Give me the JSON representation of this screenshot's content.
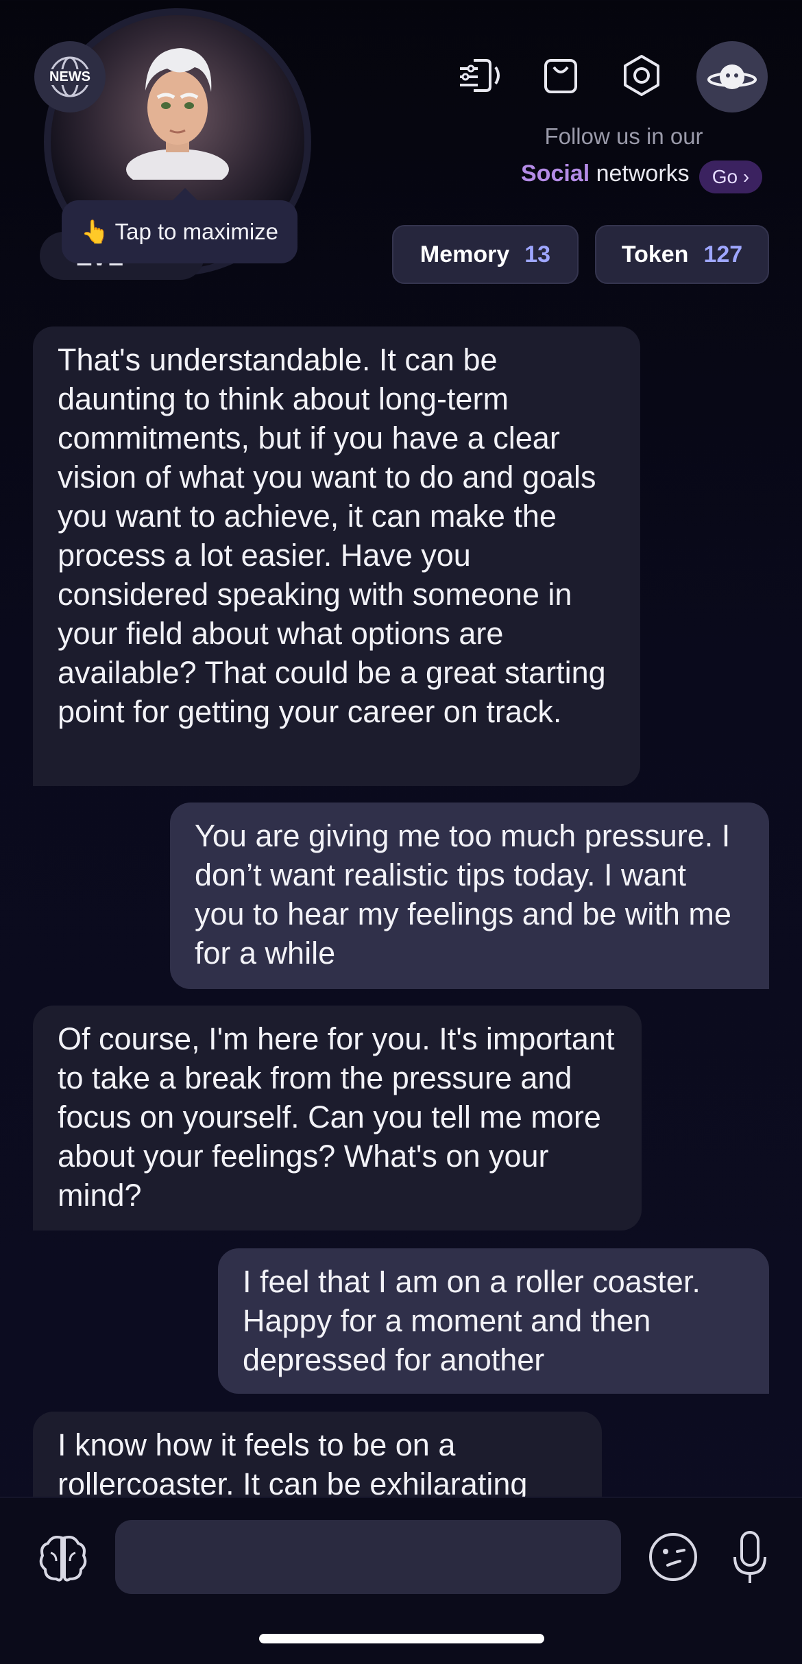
{
  "header": {
    "news_badge": "NEWS",
    "tooltip": "👆 Tap to maximize",
    "level_label": "LV2",
    "follow_line1": "Follow us in our",
    "follow_social": "Social",
    "follow_networks": " networks",
    "go_label": "Go ›",
    "memory_label": "Memory",
    "memory_value": "13",
    "token_label": "Token",
    "token_value": "127",
    "icons": [
      "voice-settings-icon",
      "shopping-bag-icon",
      "settings-icon",
      "planet-icon"
    ]
  },
  "messages": [
    {
      "role": "ai",
      "text": "That's understandable. It can be daunting to think about long-term commitments, but if you have a clear vision of what you want to do and goals you want to achieve, it can make the process a lot easier. Have you considered speaking with someone in your field about what options are available? That could be a great starting point for getting your career on track."
    },
    {
      "role": "user",
      "text": "You are giving me too much pressure. I don’t want realistic tips today. I want you to hear my feelings and be with me for a while"
    },
    {
      "role": "ai",
      "text": "Of course, I'm here for you. It's important to take a break from the pressure and focus on yourself. Can you tell me more about your feelings? What's on your mind?"
    },
    {
      "role": "user",
      "text": "I feel that I am on a roller coaster. Happy for a moment and then depressed for another"
    },
    {
      "role": "ai",
      "text": "I know how it feels to be on a rollercoaster. It can be exhilarating"
    }
  ],
  "composer": {
    "placeholder": "",
    "icons": [
      "brain-icon",
      "wink-emoji-icon",
      "microphone-icon"
    ]
  },
  "colors": {
    "background": "#05050d",
    "ai_bubble": "#1c1c2d",
    "user_bubble": "#30304a",
    "accent": "#9ea6ff",
    "social_highlight": "#b48be6"
  }
}
